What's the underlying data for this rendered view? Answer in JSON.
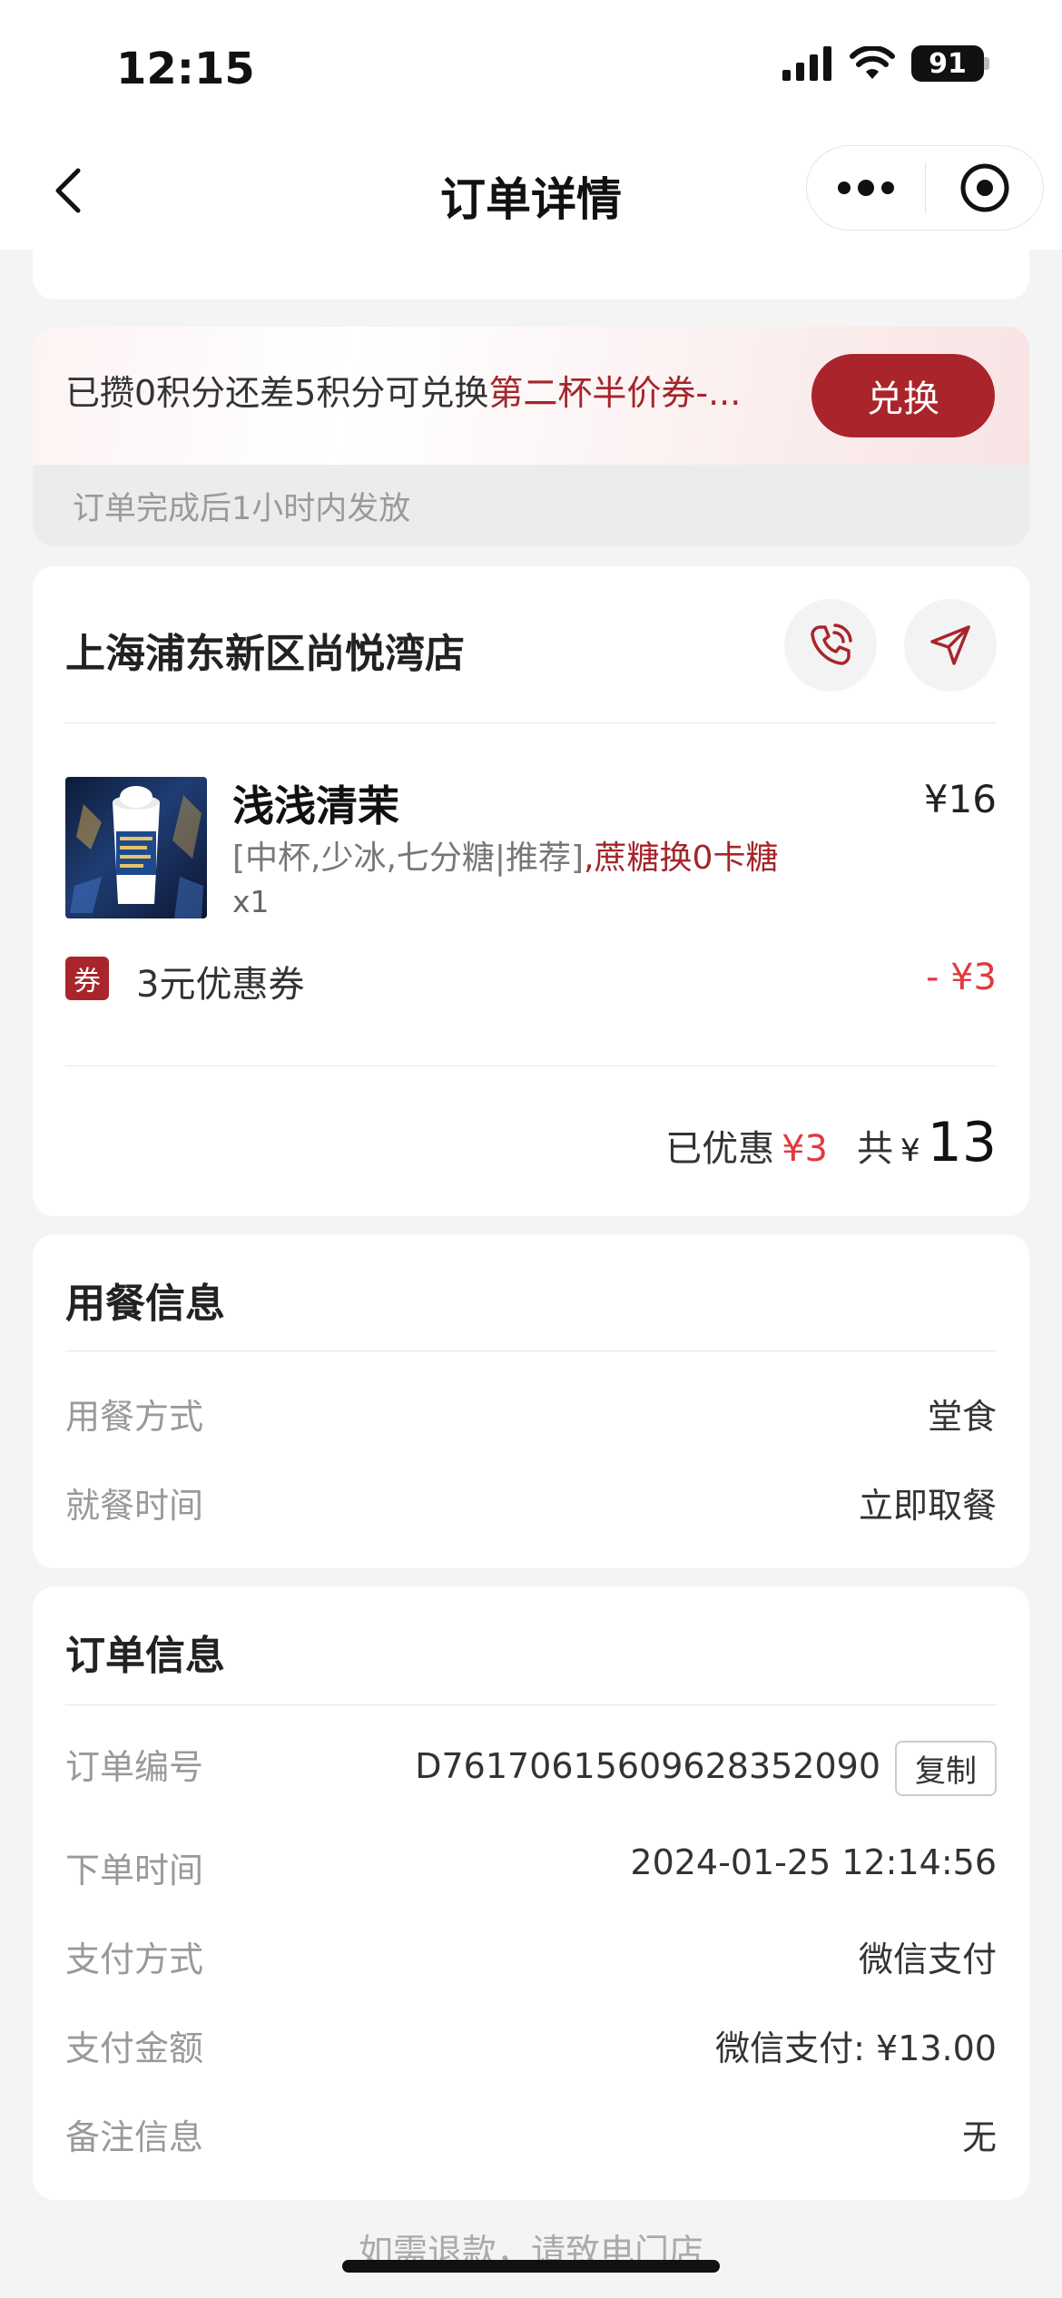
{
  "status_bar": {
    "time": "12:15",
    "battery": "91"
  },
  "nav": {
    "title": "订单详情"
  },
  "points": {
    "text_prefix": "已攒0积分还差5积分可兑换",
    "text_highlight": "第二杯半价券-...",
    "exchange_label": "兑换",
    "note": "订单完成后1小时内发放"
  },
  "store": {
    "name": "上海浦东新区尚悦湾店",
    "product": {
      "name": "浅浅清茉",
      "price": "¥16",
      "spec_normal": "[中杯,少冰,七分糖|推荐]",
      "spec_highlight": ",蔗糖换0卡糖",
      "qty": "x1"
    },
    "coupon": {
      "badge": "券",
      "label": "3元优惠券",
      "amount": "- ¥3"
    },
    "totals": {
      "discount_label": "已优惠",
      "discount_value": "¥3",
      "total_label": "共",
      "currency": "¥",
      "total_value": "13"
    }
  },
  "dining": {
    "title": "用餐信息",
    "rows": [
      {
        "label": "用餐方式",
        "value": "堂食"
      },
      {
        "label": "就餐时间",
        "value": "立即取餐"
      }
    ]
  },
  "order": {
    "title": "订单信息",
    "copy_label": "复制",
    "rows": [
      {
        "label": "订单编号",
        "value": "D76170615609628352090"
      },
      {
        "label": "下单时间",
        "value": "2024-01-25 12:14:56"
      },
      {
        "label": "支付方式",
        "value": "微信支付"
      },
      {
        "label": "支付金额",
        "value": "微信支付: ¥13.00"
      },
      {
        "label": "备注信息",
        "value": "无"
      }
    ]
  },
  "footer": {
    "hint": "如需退款，请致电门店"
  },
  "colors": {
    "brand_red": "#a9252b",
    "price_red": "#e2393f"
  }
}
